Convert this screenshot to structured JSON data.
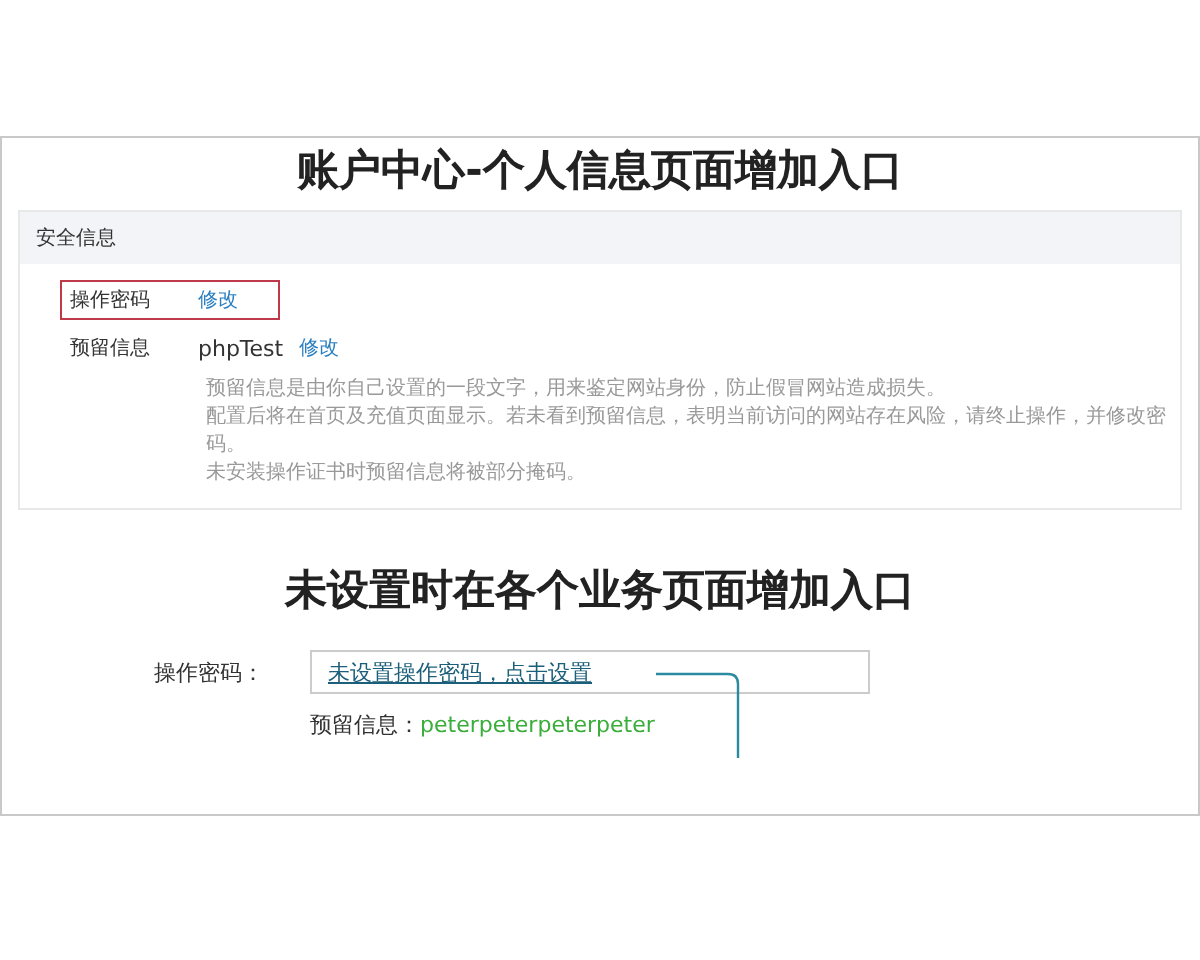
{
  "title_1": "账户中心-个人信息页面增加入口",
  "panel": {
    "heading": "安全信息",
    "rows": [
      {
        "label": "操作密码",
        "value": "",
        "link": "修改",
        "highlighted": true
      },
      {
        "label": "预留信息",
        "value": "phpTest",
        "link": "修改",
        "highlighted": false
      }
    ],
    "description": [
      "预留信息是由你自己设置的一段文字，用来鉴定网站身份，防止假冒网站造成损失。",
      "配置后将在首页及充值页面显示。若未看到预留信息，表明当前访问的网站存在风险，请终止操作，并修改密码。",
      "未安装操作证书时预留信息将被部分掩码。"
    ]
  },
  "title_2": "未设置时在各个业务页面增加入口",
  "form": {
    "password_label": "操作密码：",
    "password_link": "未设置操作密码，点击设置",
    "reserved_label": "预留信息：",
    "reserved_value": "peterpeterpeterpeter"
  }
}
